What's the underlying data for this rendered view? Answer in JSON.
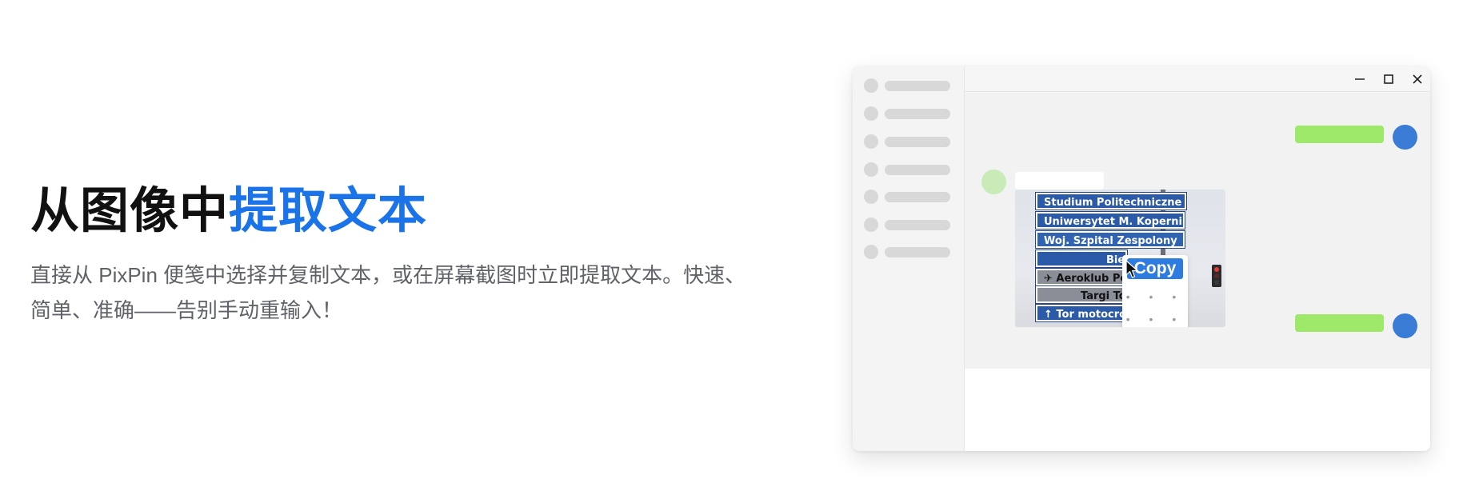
{
  "hero": {
    "title_main": "从图像中",
    "title_accent": "提取文本",
    "description": "直接从 PixPin 便笺中选择并复制文本，或在屏幕截图时立即提取文本。快速、简单、准确——告别手动重输入！"
  },
  "window": {
    "controls": [
      "minimize-icon",
      "maximize-icon",
      "close-icon"
    ]
  },
  "photo": {
    "signs": [
      "Studium Politechniczne UMK",
      "Uniwersytet M. Kopernika",
      "Woj. Szpital Zespolony",
      "Bielany",
      "✈ Aeroklub Pomorski",
      "Targi Toruńskie",
      "↑ Tor motocrossowy"
    ],
    "context_menu": {
      "copy_label": "Copy",
      "more_dots_1": "• • •",
      "more_dots_2": "• • •"
    }
  },
  "colors": {
    "accent": "#1a73e8",
    "bubble_outgoing": "#9ee86a",
    "avatar_self": "#3a7bd5",
    "avatar_other": "#c8ebb8"
  }
}
